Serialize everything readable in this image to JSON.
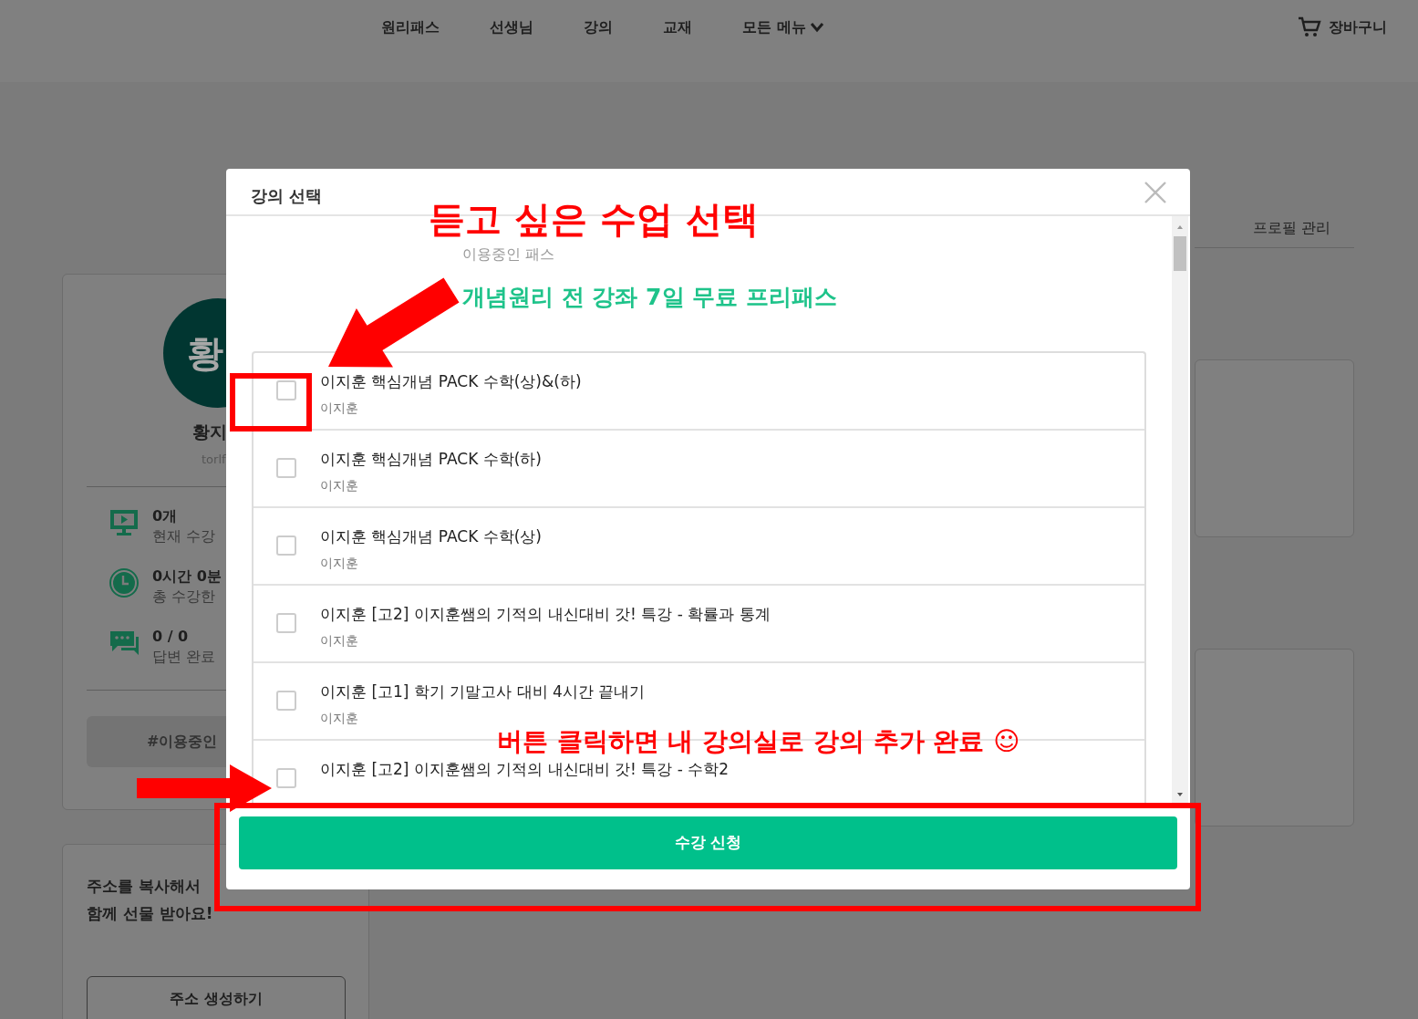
{
  "nav": {
    "items": [
      {
        "label": "원리패스",
        "dropdown": false
      },
      {
        "label": "선생님",
        "dropdown": false
      },
      {
        "label": "강의",
        "dropdown": false
      },
      {
        "label": "교재",
        "dropdown": false
      },
      {
        "label": "모든 메뉴",
        "dropdown": true
      }
    ],
    "cart": "장바구니"
  },
  "profile": {
    "avatar": "황",
    "name": "황지",
    "user_id": "torlf",
    "stats": [
      {
        "kind": "monitor",
        "value": "0개",
        "label": "현재 수강"
      },
      {
        "kind": "clock",
        "value": "0시간 0분",
        "label": "총 수강한"
      },
      {
        "kind": "chat",
        "value": "0 / 0",
        "label": "답변 완료"
      }
    ],
    "pass_tag": "#이용중인"
  },
  "invite": {
    "lines": [
      "주소를 복사해서",
      "함께 선물 받아요!"
    ],
    "button": "주소 생성하기"
  },
  "profile_tab": "프로필 관리",
  "modal": {
    "title": "강의 선택",
    "section_label": "이용중인 패스",
    "pass_name": "개념원리 전 강좌 7일 무료 프리패스",
    "courses": [
      {
        "title": "이지훈 핵심개념 PACK 수학(상)&(하)",
        "teacher": "이지훈",
        "checked": false
      },
      {
        "title": "이지훈 핵심개념 PACK 수학(하)",
        "teacher": "이지훈",
        "checked": false
      },
      {
        "title": "이지훈 핵심개념 PACK 수학(상)",
        "teacher": "이지훈",
        "checked": false
      },
      {
        "title": "이지훈 [고2] 이지훈쌤의 기적의 내신대비 갓! 특강 - 확률과 통계",
        "teacher": "이지훈",
        "checked": false
      },
      {
        "title": "이지훈 [고1] 학기 기말고사 대비 4시간 끝내기",
        "teacher": "이지훈",
        "checked": false
      },
      {
        "title": "이지훈 [고2] 이지훈쌤의 기적의 내신대비 갓! 특강 - 수학2",
        "checked": false
      }
    ],
    "submit": "수강 신청"
  },
  "annotations": [
    {
      "kind": "top",
      "text": "듣고 싶은 수업 선택"
    },
    {
      "kind": "bottom",
      "text": "버튼 클릭하면 내 강의실로 강의 추가 완료 ☺"
    }
  ]
}
